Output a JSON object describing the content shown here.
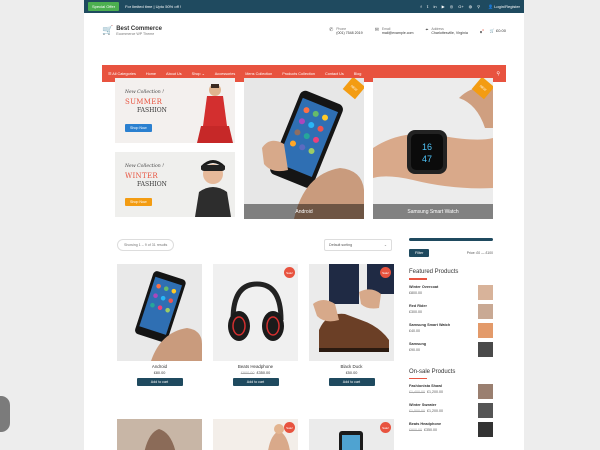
{
  "topbar": {
    "badge": "Special Offer",
    "promo": "For limited time | Upto 50% off !",
    "social_icons": [
      "f",
      "𝕥",
      "in",
      "▶",
      "◎",
      "G+",
      "◍",
      "⚲"
    ],
    "login": "Login/Register"
  },
  "header": {
    "brand": "Best Commerce",
    "tagline": "Ecommerce WP Theme",
    "contacts": [
      {
        "icon": "phone-icon",
        "glyph": "✆",
        "label": "Phone",
        "value": "(001) 7548 2019"
      },
      {
        "icon": "mail-icon",
        "glyph": "✉",
        "label": "Email",
        "value": "mail@example.com"
      },
      {
        "icon": "location-icon",
        "glyph": "⌖",
        "label": "Address",
        "value": "Charlottesville, Virginia"
      }
    ],
    "wishlist_count": "0",
    "cart_total": "£0.00"
  },
  "nav": {
    "items": [
      "All Categories",
      "Home",
      "About Us",
      "Shop ⌄",
      "Accessories",
      "Mens Collection",
      "Products Collection",
      "Contact Us",
      "Blog"
    ]
  },
  "hero": {
    "summer": {
      "new": "New Collection !",
      "title": "SUMMER",
      "sub": "FASHION",
      "button": "Shop Now"
    },
    "winter": {
      "new": "New Collection !",
      "title": "WINTER",
      "sub": "FASHION",
      "button": "Shop Now"
    },
    "features": [
      {
        "caption": "Android",
        "ribbon": "NEW"
      },
      {
        "caption": "Samsung Smart Watch",
        "ribbon": "NEW"
      }
    ]
  },
  "shop": {
    "result_count": "Showing 1 – 9 of 31 results",
    "sort": "Default sorting",
    "products": [
      {
        "name": "Android",
        "price": "£80.00",
        "old_price": "",
        "sale": "",
        "button": "Add to cart"
      },
      {
        "name": "Beats Headphone",
        "price": "£350.00",
        "old_price": "£900.00",
        "sale": "Sale!",
        "button": "Add to cart"
      },
      {
        "name": "Black Duck",
        "price": "£50.00",
        "old_price": "",
        "sale": "Sale!",
        "button": "Add to cart"
      }
    ]
  },
  "sidebar": {
    "filter_button": "Filter",
    "price_range": "Price: £0 — £100",
    "featured_title": "Featured Products",
    "featured": [
      {
        "name": "Winter Overcoat",
        "price": "£800.00",
        "old_price": ""
      },
      {
        "name": "Red Rider",
        "price": "£300.00",
        "old_price": ""
      },
      {
        "name": "Samsung Smart Watch",
        "price": "£40.00",
        "old_price": ""
      },
      {
        "name": "Samsung",
        "price": "£90.00",
        "old_price": ""
      }
    ],
    "onsale_title": "On-sale Products",
    "onsale": [
      {
        "name": "Fashionista Shawl",
        "price": "£1,200.00",
        "old_price": "£1,400.00"
      },
      {
        "name": "Winter Sweater",
        "price": "£1,200.00",
        "old_price": "£1,500.00"
      },
      {
        "name": "Beats Headphone",
        "price": "£350.00",
        "old_price": "£900.00"
      }
    ]
  },
  "colors": {
    "accent": "#e8533f",
    "dark": "#1f4a5f",
    "success": "#4caf50"
  }
}
